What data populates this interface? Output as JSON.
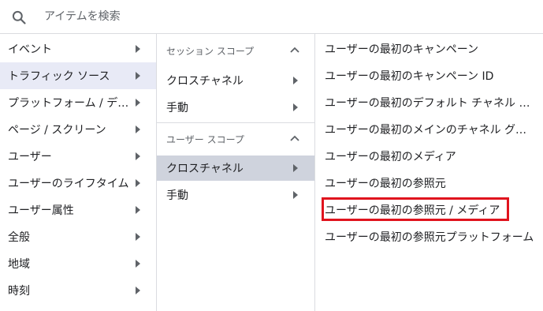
{
  "search": {
    "placeholder": "アイテムを検索",
    "icon": "search-icon"
  },
  "categories": [
    {
      "label": "イベント"
    },
    {
      "label": "トラフィック ソース"
    },
    {
      "label": "プラットフォーム / デバイス"
    },
    {
      "label": "ページ / スクリーン"
    },
    {
      "label": "ユーザー"
    },
    {
      "label": "ユーザーのライフタイム"
    },
    {
      "label": "ユーザー属性"
    },
    {
      "label": "全般"
    },
    {
      "label": "地域"
    },
    {
      "label": "時刻"
    }
  ],
  "active_category": "トラフィック ソース",
  "scopes": {
    "session_header": "セッション スコープ",
    "session_items": [
      {
        "label": "クロスチャネル"
      },
      {
        "label": "手動"
      }
    ],
    "user_header": "ユーザー スコープ",
    "user_items": [
      {
        "label": "クロスチャネル"
      },
      {
        "label": "手動"
      }
    ]
  },
  "dimensions": [
    {
      "label": "ユーザーの最初のキャンペーン"
    },
    {
      "label": "ユーザーの最初のキャンペーン ID"
    },
    {
      "label": "ユーザーの最初のデフォルト チャネル グループ"
    },
    {
      "label": "ユーザーの最初のメインのチャネル グループ"
    },
    {
      "label": "ユーザーの最初のメディア"
    },
    {
      "label": "ユーザーの最初の参照元"
    },
    {
      "label": "ユーザーの最初の参照元 / メディア"
    },
    {
      "label": "ユーザーの最初の参照元プラットフォーム"
    }
  ],
  "highlight_color": "#e0141e",
  "active_bg_color": "#e8eaf6",
  "selected_scope_bg": "#cfd3dd"
}
